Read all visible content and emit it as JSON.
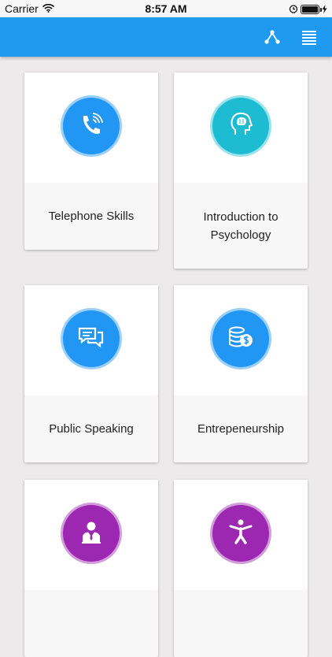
{
  "status": {
    "carrier": "Carrier",
    "time": "8:57 AM",
    "battery_level": 0.9
  },
  "appbar": {
    "color": "#1e9bf0",
    "actions": [
      {
        "icon": "share-nodes-icon"
      },
      {
        "icon": "list-menu-icon"
      }
    ]
  },
  "courses": [
    {
      "title": "Telephone Skills",
      "icon": "phone-icon",
      "color": "#2196f3"
    },
    {
      "title": "Introduction to Psychology",
      "icon": "brain-head-icon",
      "color": "#1ebcd2"
    },
    {
      "title": "Public Speaking",
      "icon": "speech-bubbles-icon",
      "color": "#2196f3"
    },
    {
      "title": "Entrepeneurship",
      "icon": "coins-dollar-icon",
      "color": "#2196f3"
    },
    {
      "title": "",
      "icon": "businessman-icon",
      "color": "#9c27b0"
    },
    {
      "title": "",
      "icon": "accessibility-person-icon",
      "color": "#9c27b0"
    }
  ]
}
